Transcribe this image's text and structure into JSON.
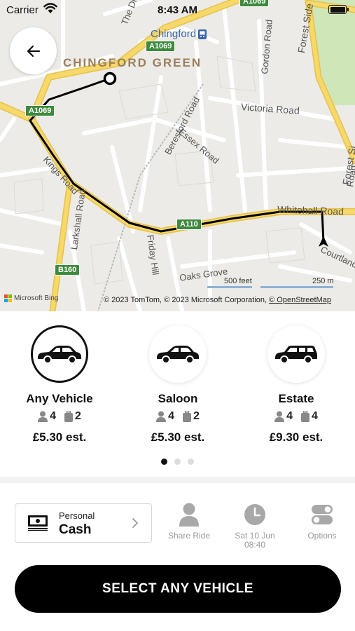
{
  "status_bar": {
    "carrier": "Carrier",
    "time": "8:43 AM"
  },
  "map": {
    "area_label": "CHINGFORD GREEN",
    "station_label": "Chingford",
    "road_shields": [
      "A1069",
      "A1069",
      "A1069",
      "A110",
      "B160"
    ],
    "road_labels": [
      "The Drive",
      "Gordon Road",
      "Forest Side",
      "Victoria Road",
      "Beresford Road",
      "Essex Road",
      "Kings Road",
      "Larkshall Road",
      "Friday Hill",
      "Whitehall Road",
      "Oaks Grove",
      "Courtland",
      "Forest Si",
      "Road"
    ],
    "scale_feet": "500 feet",
    "scale_meters": "250 m",
    "provider": "Microsoft Bing",
    "attribution_prefix": "© 2023 TomTom, © 2023 Microsoft Corporation, ",
    "attribution_link": "© OpenStreetMap",
    "colors": {
      "route": "#000000",
      "major_road": "#f7d86a",
      "park": "#cfe6b8",
      "shield": "#3d8a3d"
    }
  },
  "vehicles": [
    {
      "name": "Any Vehicle",
      "passengers": "4",
      "luggage": "2",
      "price": "£5.30 est.",
      "selected": true,
      "icon": "car-sedan-icon"
    },
    {
      "name": "Saloon",
      "passengers": "4",
      "luggage": "2",
      "price": "£5.30 est.",
      "selected": false,
      "icon": "car-saloon-icon"
    },
    {
      "name": "Estate",
      "passengers": "4",
      "luggage": "4",
      "price": "£9.30 est.",
      "selected": false,
      "icon": "car-estate-icon"
    }
  ],
  "pager": {
    "pages": 3,
    "current": 1
  },
  "payment": {
    "type": "Personal",
    "method": "Cash",
    "icon": "cash-icon"
  },
  "options": [
    {
      "label": "Share Ride",
      "icon": "person-icon"
    },
    {
      "label_line1": "Sat 10 Jun",
      "label_line2": "08:40",
      "icon": "clock-icon"
    },
    {
      "label": "Options",
      "icon": "toggles-icon"
    }
  ],
  "primary_action": {
    "label": "SELECT ANY VEHICLE"
  }
}
